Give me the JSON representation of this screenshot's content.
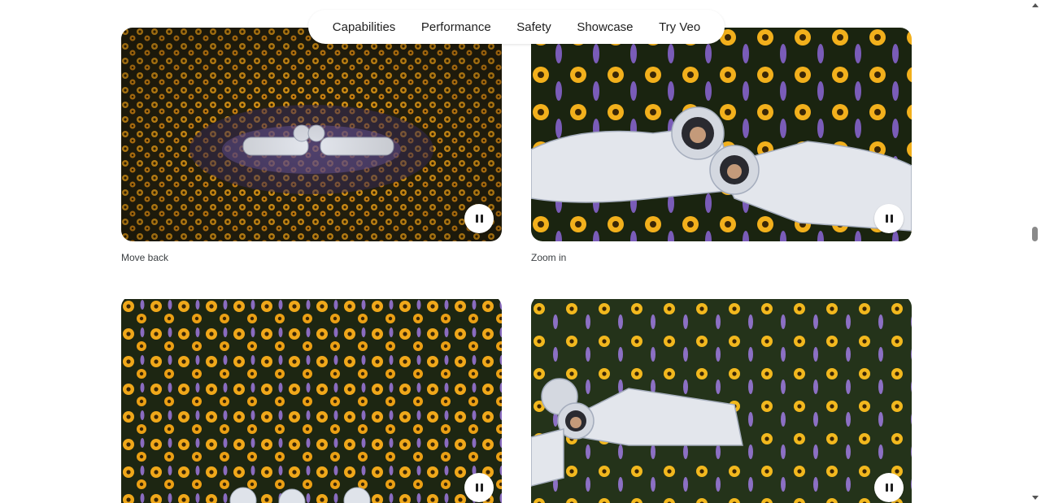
{
  "nav": {
    "items": [
      {
        "label": "Capabilities"
      },
      {
        "label": "Performance"
      },
      {
        "label": "Safety"
      },
      {
        "label": "Showcase"
      },
      {
        "label": "Try Veo"
      }
    ]
  },
  "videos": [
    {
      "caption": "Move back",
      "alt": "two-astronauts-lying-in-flower-field-far",
      "state": "playing",
      "control_icon": "pause-icon"
    },
    {
      "caption": "Zoom in",
      "alt": "two-astronauts-lying-in-flower-field-close",
      "state": "playing",
      "control_icon": "pause-icon"
    },
    {
      "caption": "",
      "alt": "flower-field-overhead",
      "state": "playing",
      "control_icon": "pause-icon"
    },
    {
      "caption": "",
      "alt": "astronauts-in-flower-field-side",
      "state": "playing",
      "control_icon": "pause-icon"
    }
  ],
  "colors": {
    "background": "#ffffff",
    "text": "#1f1f1f",
    "flower_yellow": "#f2a81a",
    "foliage": "#1e2a12",
    "lupine_purple": "#8a6cc0",
    "suit_white": "#e3e6ec"
  }
}
